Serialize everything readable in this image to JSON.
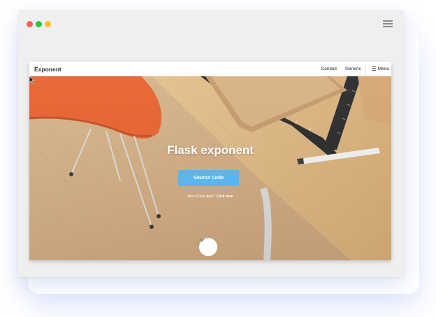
{
  "window": {
    "controls": {
      "close_color": "#ff5f57",
      "minimize_color": "#28c840",
      "maximize_color": "#ffbd2e"
    },
    "menu_icon": "hamburger-icon"
  },
  "site": {
    "brand": "Exponent",
    "nav": {
      "contact": "Contact",
      "generic": "Generic",
      "menu": "Menu"
    },
    "hero": {
      "title": "Flask exponent",
      "button": "Source Code",
      "more_prefix": "More Flask apps? ",
      "more_link": "Click here",
      "scroll_icon": "chevron-down-icon"
    }
  },
  "colors": {
    "accent": "#5ab6ee",
    "chair": "#e8622f"
  }
}
